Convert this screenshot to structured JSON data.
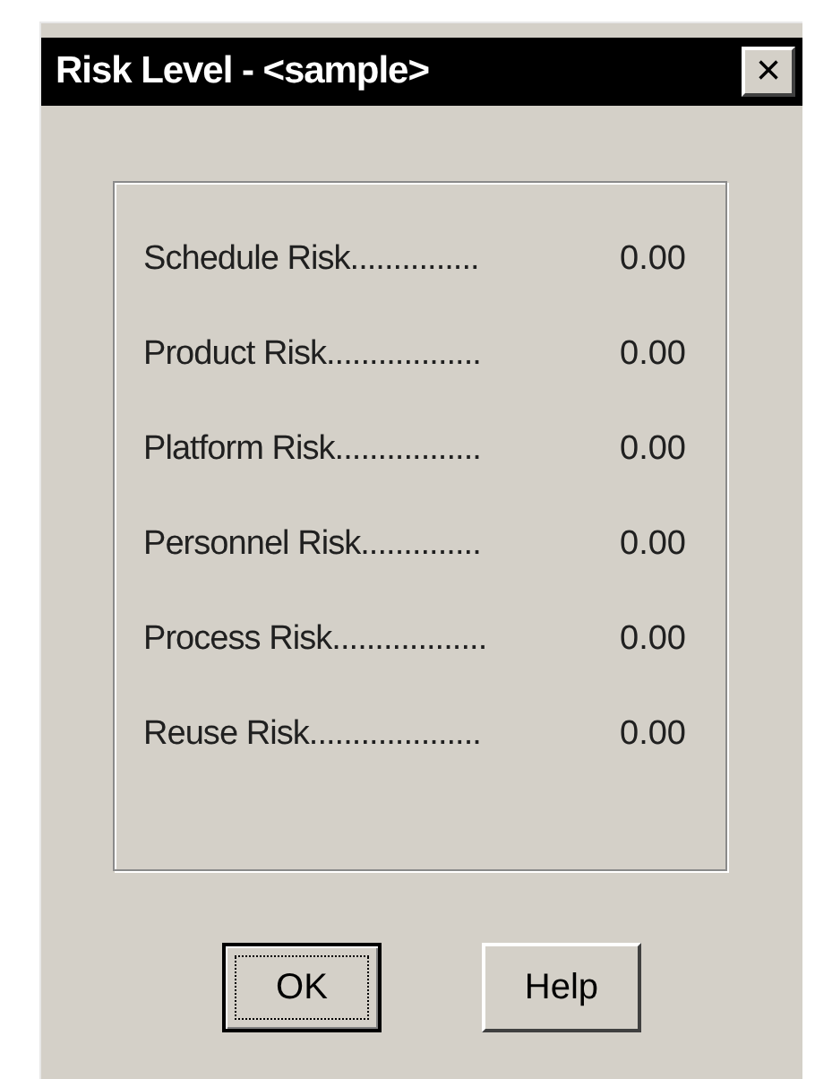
{
  "window": {
    "title": "Risk Level - <sample>",
    "close": "×"
  },
  "risks": [
    {
      "label": "Schedule Risk...............",
      "value": "0.00"
    },
    {
      "label": "Product Risk..................",
      "value": "0.00"
    },
    {
      "label": "Platform Risk.................",
      "value": "0.00"
    },
    {
      "label": "Personnel Risk..............",
      "value": "0.00"
    },
    {
      "label": "Process Risk..................",
      "value": "0.00"
    },
    {
      "label": "Reuse Risk....................",
      "value": "0.00"
    }
  ],
  "buttons": [
    {
      "label": "OK",
      "focused": true
    },
    {
      "label": "Help",
      "focused": false
    }
  ]
}
